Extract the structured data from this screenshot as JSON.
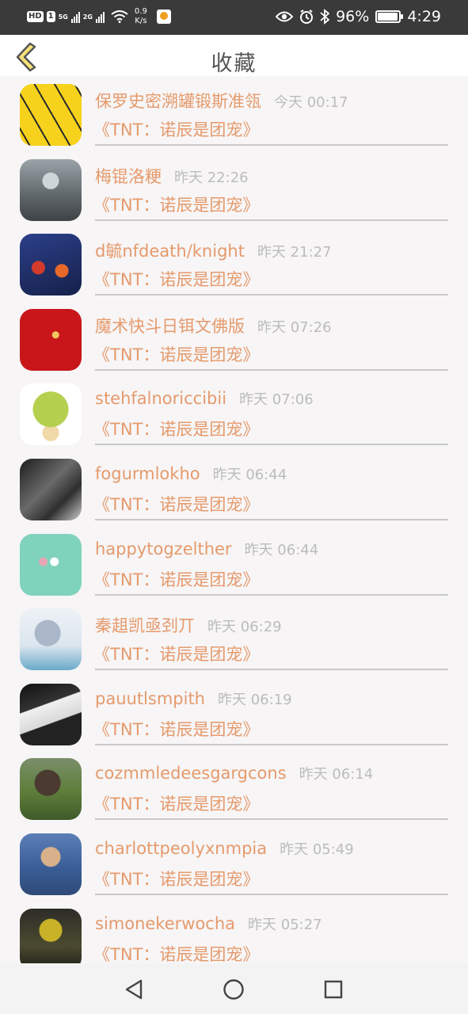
{
  "status_bar": {
    "hd_label": "HD",
    "sim_label": "1",
    "net_5g": "5G",
    "net_2g": "2G",
    "speed_value": "0.9",
    "speed_unit": "K/s",
    "battery_percent": 96,
    "battery_text": "96%",
    "time": "4:29",
    "icons": [
      "eye-icon",
      "alarm-icon",
      "bluetooth-icon",
      "wifi-icon",
      "battery-icon"
    ]
  },
  "header": {
    "title": "收藏",
    "back_icon": "chevron-left-icon"
  },
  "colors": {
    "accent": "#e59a6c",
    "timestamp": "#bcbcbc",
    "divider": "#c9c9c9",
    "status_bar_bg": "#3a3a3a",
    "back_icon_fill": "#f5e27a",
    "back_icon_stroke": "#555555"
  },
  "items": [
    {
      "username": "保罗史密溯罐锻斯准瓴",
      "timestamp": "今天 00:17",
      "book": "《TNT：诺辰是团宠》"
    },
    {
      "username": "梅锟洛粳",
      "timestamp": "昨天 22:26",
      "book": "《TNT：诺辰是团宠》"
    },
    {
      "username": "d毓nfdeath/knight",
      "timestamp": "昨天 21:27",
      "book": "《TNT：诺辰是团宠》"
    },
    {
      "username": "魔术快斗日铒文佛版",
      "timestamp": "昨天 07:26",
      "book": "《TNT：诺辰是团宠》"
    },
    {
      "username": "stehfalnoriccibii",
      "timestamp": "昨天 07:06",
      "book": "《TNT：诺辰是团宠》"
    },
    {
      "username": "fogurmlokho",
      "timestamp": "昨天 06:44",
      "book": "《TNT：诺辰是团宠》"
    },
    {
      "username": "happytogzelther",
      "timestamp": "昨天 06:44",
      "book": "《TNT：诺辰是团宠》"
    },
    {
      "username": "秦趄凯亟刭丌",
      "timestamp": "昨天 06:29",
      "book": "《TNT：诺辰是团宠》"
    },
    {
      "username": "pauutlsmpith",
      "timestamp": "昨天 06:19",
      "book": "《TNT：诺辰是团宠》"
    },
    {
      "username": "cozmmledeesgargcons",
      "timestamp": "昨天 06:14",
      "book": "《TNT：诺辰是团宠》"
    },
    {
      "username": "charlottpeolyxnmpia",
      "timestamp": "昨天 05:49",
      "book": "《TNT：诺辰是团宠》"
    },
    {
      "username": "simonekerwocha",
      "timestamp": "昨天 05:27",
      "book": "《TNT：诺辰是团宠》"
    }
  ],
  "nav_bar": {
    "icons": [
      "back-triangle-icon",
      "home-circle-icon",
      "recents-square-icon"
    ]
  }
}
